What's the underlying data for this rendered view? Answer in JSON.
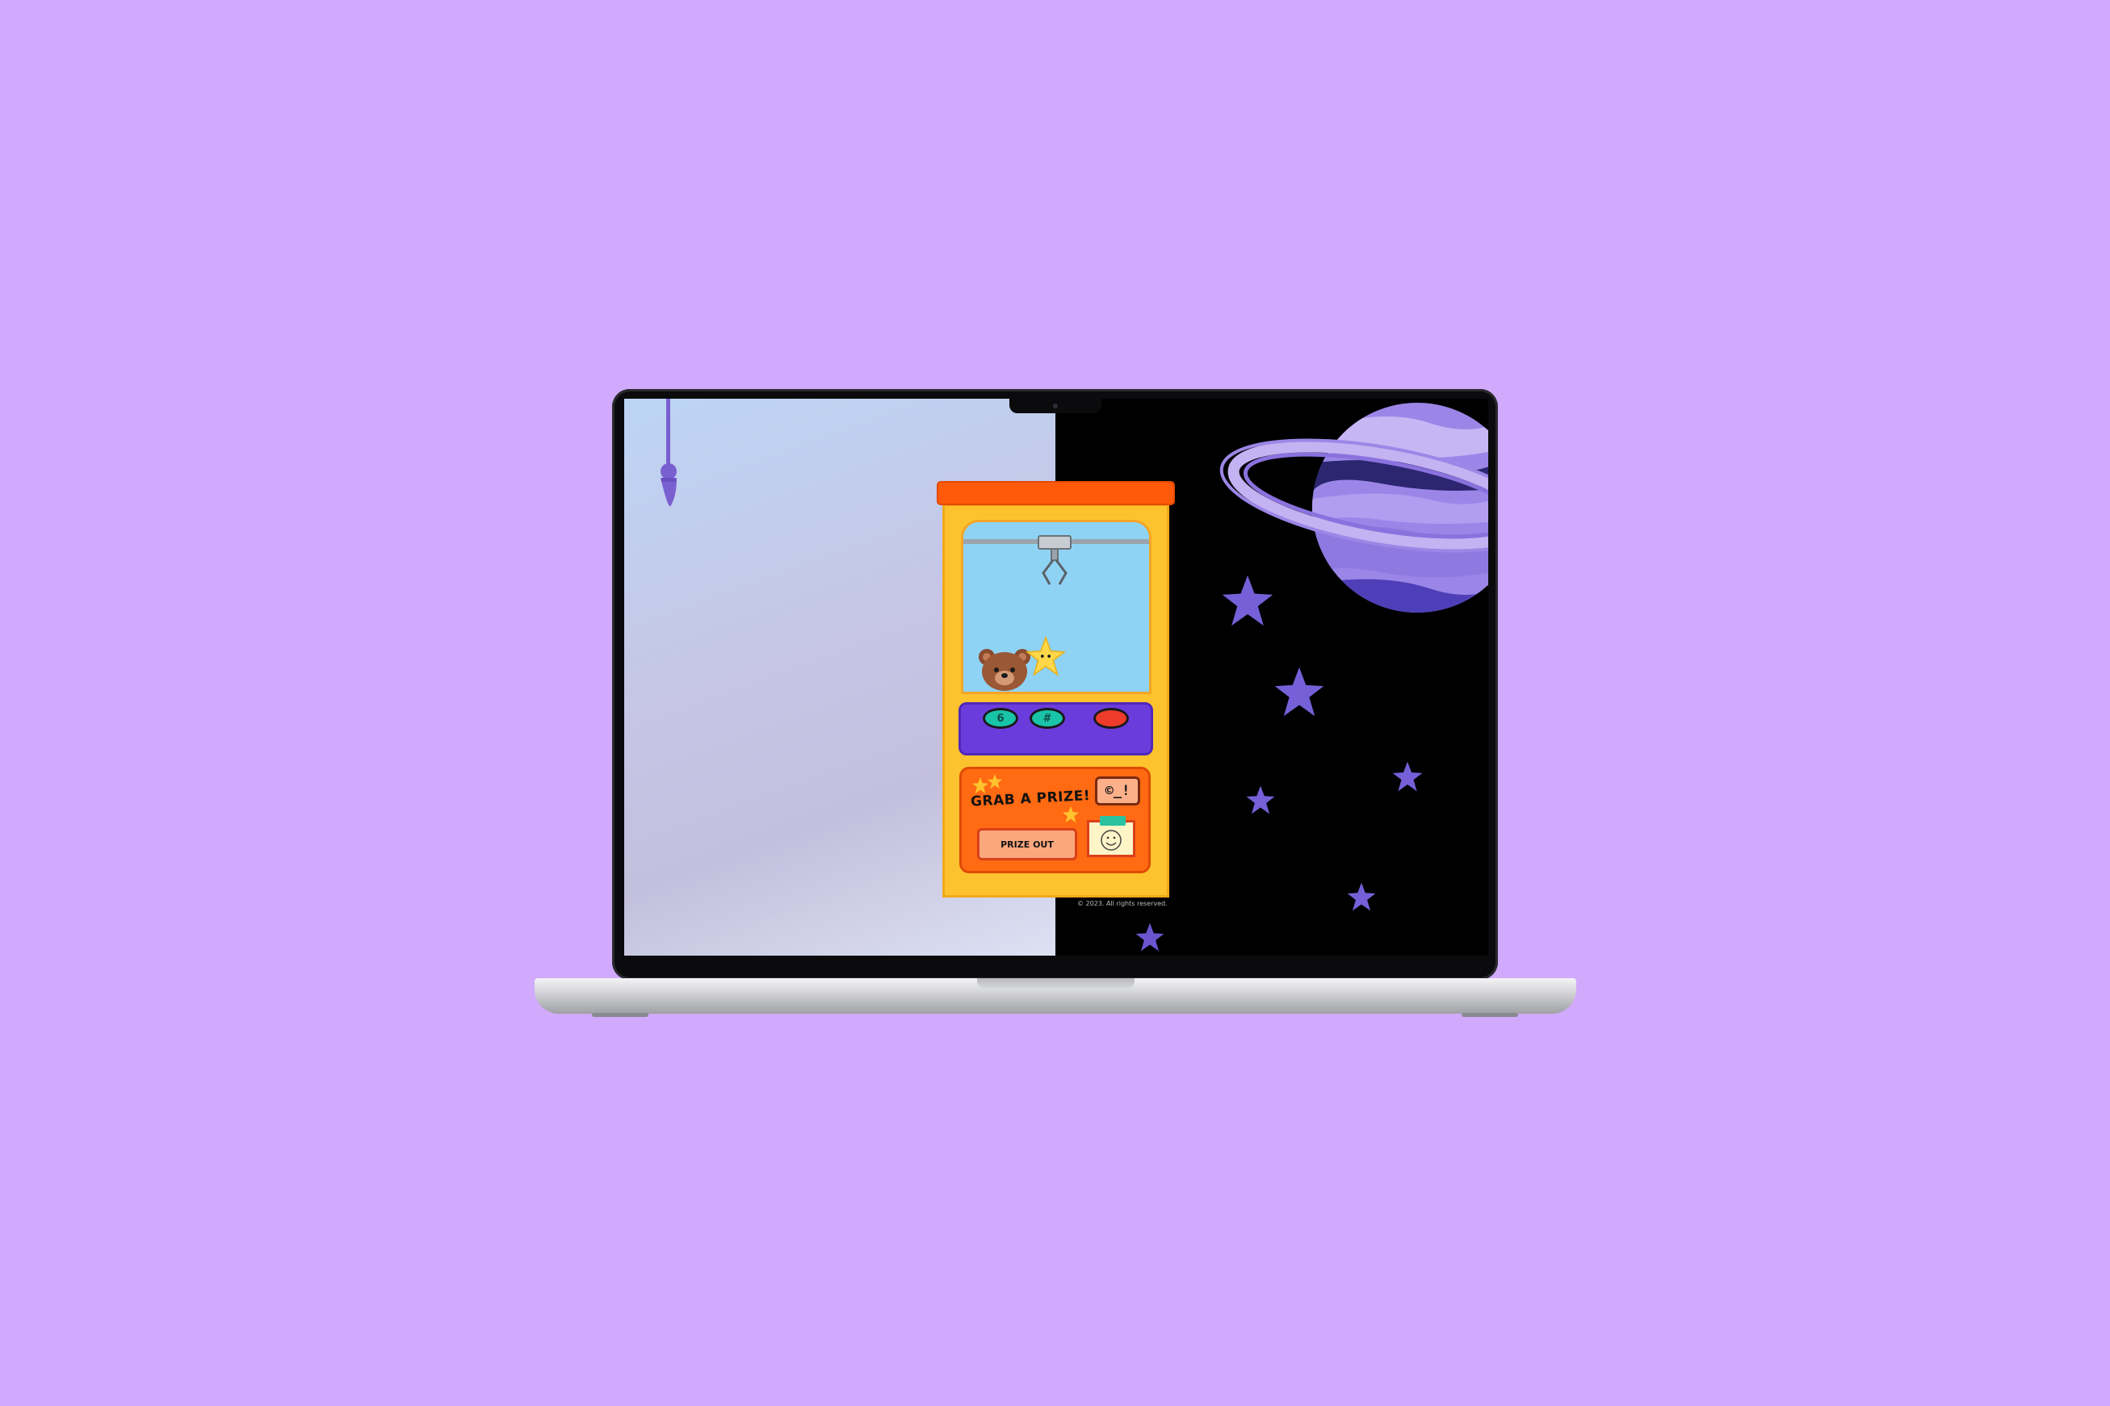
{
  "machine": {
    "title": "GRAB A PRIZE!",
    "button_1": "6",
    "button_2": "#",
    "coin_label": "©_!",
    "prize_out_label": "PRIZE OUT",
    "footer": "© 2023. All rights reserved."
  },
  "colors": {
    "background": "#d1aafd",
    "machine_body": "#fdc32e",
    "machine_top": "#ff5a0a",
    "glass": "#8fd3f4",
    "control_panel": "#6b3cdc",
    "star": "#7560d8",
    "planet": "#7a5fd0"
  },
  "icons": [
    "claw-icon",
    "teddy-bear-icon",
    "star-plush-icon",
    "rope-claw-icon",
    "planet-icon",
    "star-icon",
    "smiley-photo-icon"
  ]
}
